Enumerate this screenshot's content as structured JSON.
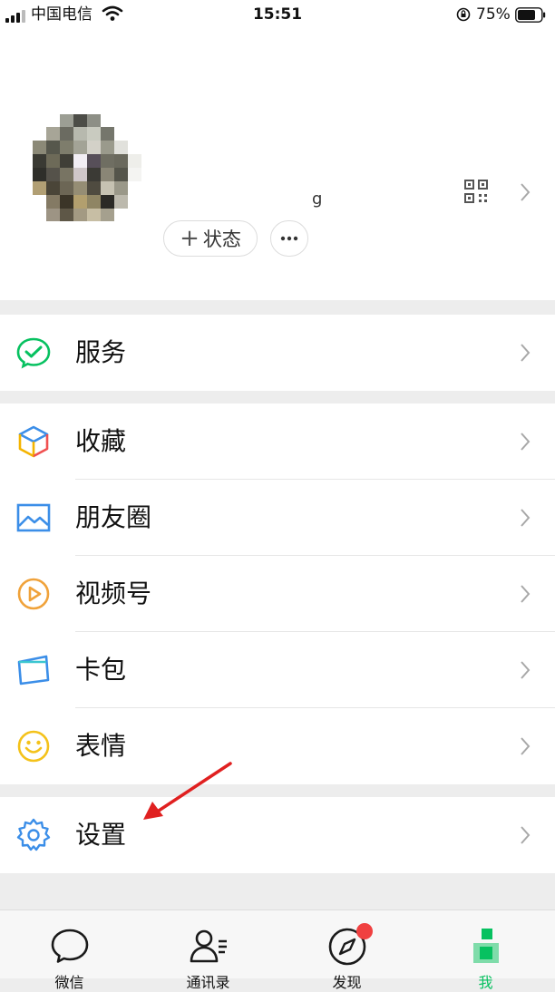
{
  "status_bar": {
    "carrier": "中国电信",
    "time": "15:51",
    "battery": "75%"
  },
  "profile": {
    "name_fragment": "g",
    "status_button": "状态",
    "status_plus": "+"
  },
  "menu": {
    "service": "服务",
    "favorites": "收藏",
    "moments": "朋友圈",
    "channels": "视频号",
    "cards": "卡包",
    "stickers": "表情",
    "settings": "设置"
  },
  "tabs": {
    "chats": "微信",
    "contacts": "通讯录",
    "discover": "发现",
    "me": "我"
  },
  "colors": {
    "accent_green": "#07c160",
    "badge_red": "#f04040",
    "arrow_red": "#e02020"
  }
}
